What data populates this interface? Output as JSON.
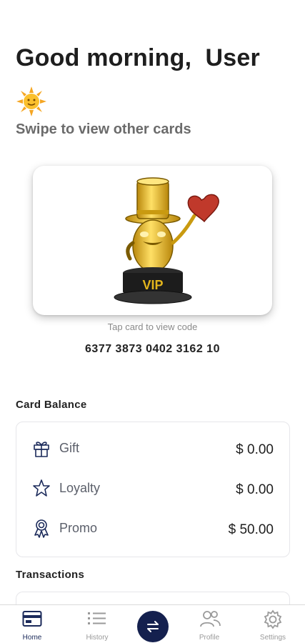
{
  "header": {
    "greeting": "Good morning,  User",
    "weather_icon": "sun-icon",
    "subtitle": "Swipe to view other cards"
  },
  "card": {
    "image": "vip-trophy-mascot",
    "tap_hint": "Tap card to view code",
    "number": "6377 3873 0402 3162 10"
  },
  "balance": {
    "title": "Card Balance",
    "rows": [
      {
        "icon": "gift-icon",
        "label": "Gift",
        "value": "$ 0.00"
      },
      {
        "icon": "star-icon",
        "label": "Loyalty",
        "value": "$ 0.00"
      },
      {
        "icon": "award-ribbon-icon",
        "label": "Promo",
        "value": "$ 50.00"
      }
    ]
  },
  "transactions": {
    "title": "Transactions"
  },
  "nav": {
    "items": [
      {
        "icon": "card-icon",
        "label": "Home",
        "active": true
      },
      {
        "icon": "list-icon",
        "label": "History",
        "active": false
      },
      {
        "icon": "transfer-arrows-icon",
        "label": "",
        "active": false
      },
      {
        "icon": "people-icon",
        "label": "Profile",
        "active": false
      },
      {
        "icon": "gear-icon",
        "label": "Settings",
        "active": false
      }
    ]
  },
  "colors": {
    "accent": "#14204e",
    "gold": "#e3b51c",
    "text_muted": "#6b6b6b"
  }
}
